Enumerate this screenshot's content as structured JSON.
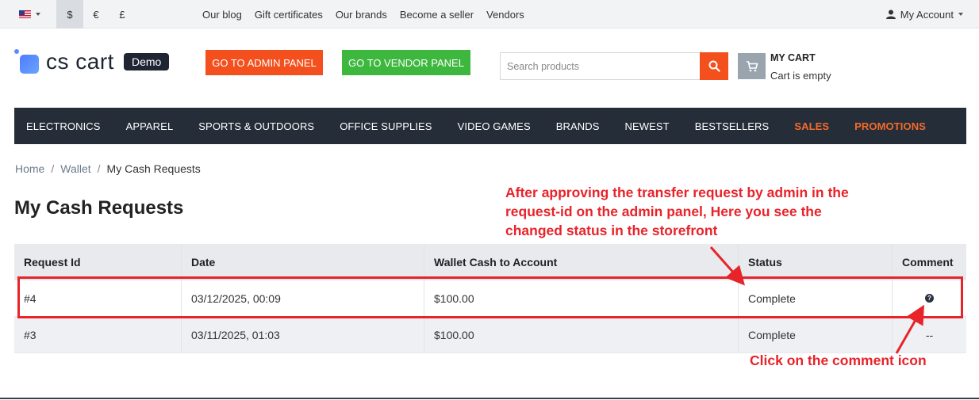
{
  "topbar": {
    "currencies": [
      "$",
      "€",
      "£"
    ],
    "active_currency": "$",
    "links": [
      "Our blog",
      "Gift certificates",
      "Our brands",
      "Become a seller",
      "Vendors"
    ],
    "account_label": "My Account"
  },
  "header": {
    "logo_text": "cs cart",
    "demo_badge": "Demo",
    "admin_button": "GO TO ADMIN PANEL",
    "vendor_button": "GO TO VENDOR PANEL",
    "search_placeholder": "Search products",
    "cart_title": "MY CART",
    "cart_status": "Cart is empty"
  },
  "nav": {
    "items": [
      "ELECTRONICS",
      "APPAREL",
      "SPORTS & OUTDOORS",
      "OFFICE SUPPLIES",
      "VIDEO GAMES",
      "BRANDS",
      "NEWEST",
      "BESTSELLERS",
      "SALES",
      "PROMOTIONS"
    ]
  },
  "breadcrumb": {
    "home": "Home",
    "wallet": "Wallet",
    "current": "My Cash Requests",
    "separator": "/"
  },
  "page_title": "My Cash Requests",
  "table": {
    "headers": [
      "Request Id",
      "Date",
      "Wallet Cash to Account",
      "Status",
      "Comment"
    ],
    "rows": [
      {
        "id": "#4",
        "date": "03/12/2025, 00:09",
        "amount": "$100.00",
        "status": "Complete",
        "comment": "?"
      },
      {
        "id": "#3",
        "date": "03/11/2025, 01:03",
        "amount": "$100.00",
        "status": "Complete",
        "comment": "--"
      }
    ]
  },
  "annotations": {
    "top_note": "After approving the transfer request by admin in the request-id on the admin panel, Here you see the changed status in the storefront",
    "bottom_note": "Click on the comment icon",
    "color": "#e8232a"
  },
  "colors": {
    "accent_orange": "#f4501e",
    "vendor_green": "#3eb73f",
    "nav_bg": "#252d38",
    "nav_highlight": "#f46a2a"
  }
}
